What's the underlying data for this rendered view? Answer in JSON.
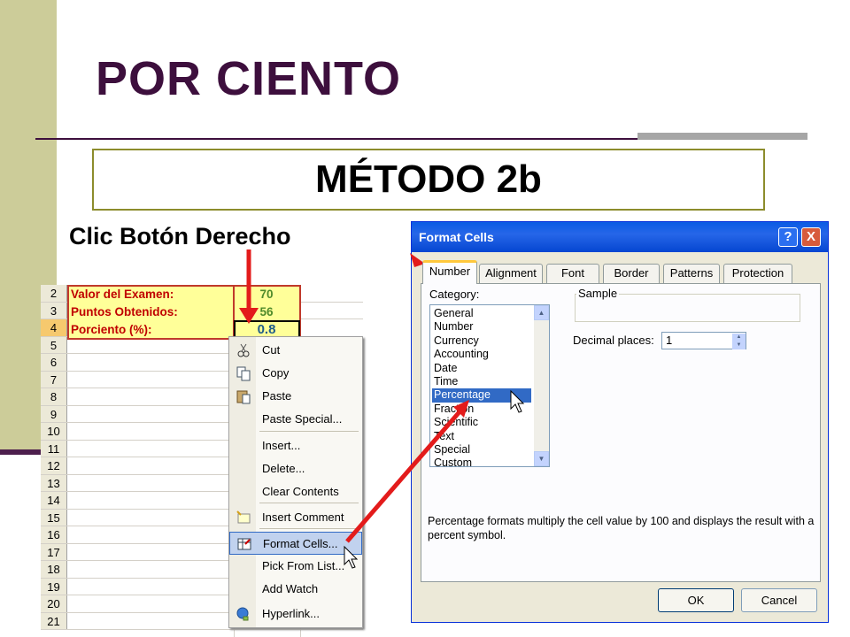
{
  "slide": {
    "title": "POR CIENTO",
    "method": "MÉTODO 2b",
    "instruction": "Clic Botón Derecho"
  },
  "sheet": {
    "rows": [
      "2",
      "3",
      "4",
      "5",
      "6",
      "7",
      "8",
      "9",
      "10",
      "11",
      "12",
      "13",
      "14",
      "15",
      "16",
      "17",
      "18",
      "19",
      "20",
      "21"
    ],
    "labels": [
      "Valor del Examen:",
      "Puntos Obtenidos:",
      "Porciento (%):"
    ],
    "values": [
      "70",
      "56",
      "0.8"
    ]
  },
  "context_menu": {
    "items": [
      {
        "label": "Cut",
        "icon": "scissors-icon"
      },
      {
        "label": "Copy",
        "icon": "copy-icon"
      },
      {
        "label": "Paste",
        "icon": "paste-icon"
      },
      {
        "label": "Paste Special...",
        "icon": ""
      },
      {
        "label": "Insert...",
        "icon": ""
      },
      {
        "label": "Delete...",
        "icon": ""
      },
      {
        "label": "Clear Contents",
        "icon": ""
      },
      {
        "label": "Insert Comment",
        "icon": "comment-icon"
      },
      {
        "label": "Format Cells...",
        "icon": "format-cells-icon"
      },
      {
        "label": "Pick From List...",
        "icon": ""
      },
      {
        "label": "Add Watch",
        "icon": ""
      },
      {
        "label": "Hyperlink...",
        "icon": "hyperlink-icon"
      }
    ],
    "highlighted": "Format Cells..."
  },
  "dialog": {
    "title": "Format Cells",
    "tabs": [
      "Number",
      "Alignment",
      "Font",
      "Border",
      "Patterns",
      "Protection"
    ],
    "active_tab": "Number",
    "category_label": "Category:",
    "categories": [
      "General",
      "Number",
      "Currency",
      "Accounting",
      "Date",
      "Time",
      "Percentage",
      "Fraction",
      "Scientific",
      "Text",
      "Special",
      "Custom"
    ],
    "selected_category": "Percentage",
    "sample_label": "Sample",
    "decimal_label": "Decimal places:",
    "decimal_value": "1",
    "description": "Percentage formats multiply the cell value by 100 and displays the result with a percent symbol.",
    "ok_label": "OK",
    "cancel_label": "Cancel",
    "help_label": "?",
    "close_label": "X"
  },
  "colors": {
    "title": "#3d0f3d",
    "band": "#cccc99",
    "arrow": "#e31b1b",
    "titlebar": "#0a5be4"
  }
}
